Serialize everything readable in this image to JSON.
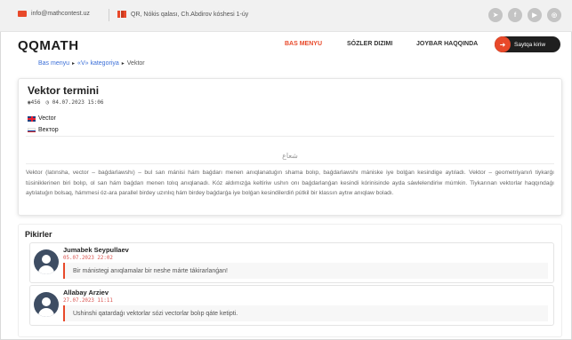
{
  "topbar": {
    "email": "info@mathcontest.uz",
    "address": "QR, Nókis qalası, Ch.Abdirov kóshesi 1-úy",
    "social": [
      "telegram-icon",
      "facebook-icon",
      "youtube-icon",
      "instagram-icon"
    ]
  },
  "brand": {
    "logo": "QQMATH"
  },
  "nav": {
    "home": "BAS MENYU",
    "dictionary": "SÓZLER DIZIMI",
    "joybar": "JOYBAR HAQQINDA",
    "login": "Saytqa kiriw"
  },
  "breadcrumb": {
    "home": "Bas menyu",
    "category": "«V» kategoriya",
    "current": "Vektor"
  },
  "article": {
    "title": "Vektor termini",
    "views": "456",
    "date": "04.07.2023 15:06",
    "english": "Vector",
    "russian": "Вектор",
    "arabic": "ﺷﻌﺎﻉ",
    "description": "Vektor (latınsha, vector – baǵdarlawshı) – bul san mánisi hám baǵdarı menen anıqlanatuǵın shama bolıp, baǵdarlawshı mániske iye bolǵan kesindige aytıladı. Vektor – geometriyanıń tiykarǵı túsiniklerinen biri bolıp, ol san hám baǵdarı menen tolıq anıqlanadı. Kóz aldımızǵa keltiriw ushın onı baǵdarlanǵan kesindi kórinisinde ayda sáwlelendiriw múmkin. Tiykarınan vektorlar haqqındaǵı aytılatuǵın bolsaq, hámmesi óz-ara parallel birdey uzınlıq hám birdey baǵdarǵa iye bolǵan kesindilerdiń pútkil bir klassın aytıw anıqlaw boladı."
  },
  "comments": {
    "title": "Pikirler",
    "items": [
      {
        "name": "Jumabek Seypullaev",
        "date": "05.07.2023 22:02",
        "text": "Bir mánistegi anıqlamalar bir neshe márte tákirarlanǵan!"
      },
      {
        "name": "Allabay Arziev",
        "date": "27.07.2023 11:11",
        "text": "Ushinshi qatardaǵı vektorlar sózi vectorlar bolıp qáte ketipti."
      }
    ]
  },
  "colors": {
    "accent": "#e8492a",
    "link": "#3b6fd8",
    "dark": "#1f1f1f"
  }
}
